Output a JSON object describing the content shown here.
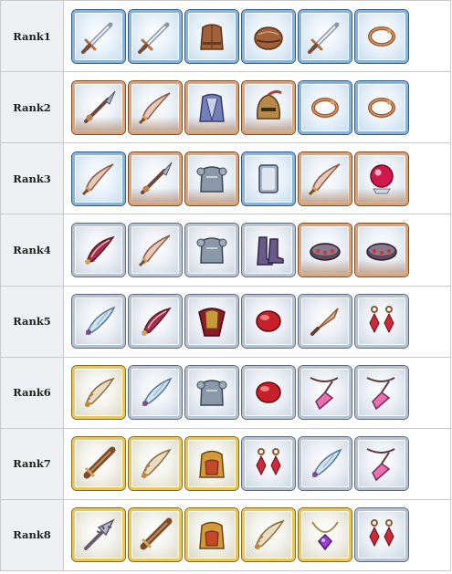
{
  "ranks": [
    {
      "label": "Rank1",
      "items": [
        {
          "frame": "blue",
          "icon": "sword-icon"
        },
        {
          "frame": "blue",
          "icon": "sword-icon"
        },
        {
          "frame": "blue",
          "icon": "leather-armor-icon"
        },
        {
          "frame": "blue",
          "icon": "leather-helmet-icon"
        },
        {
          "frame": "blue",
          "icon": "sword-icon"
        },
        {
          "frame": "blue",
          "icon": "bracelet-icon"
        }
      ]
    },
    {
      "label": "Rank2",
      "items": [
        {
          "frame": "bronze",
          "icon": "spear-icon"
        },
        {
          "frame": "bronze",
          "icon": "scimitar-icon"
        },
        {
          "frame": "bronze",
          "icon": "robe-armor-icon"
        },
        {
          "frame": "bronze",
          "icon": "knight-helmet-icon"
        },
        {
          "frame": "blue",
          "icon": "bracelet-icon"
        },
        {
          "frame": "blue",
          "icon": "bracelet-icon"
        }
      ]
    },
    {
      "label": "Rank3",
      "items": [
        {
          "frame": "blue",
          "icon": "scimitar-icon"
        },
        {
          "frame": "bronze",
          "icon": "spear-icon"
        },
        {
          "frame": "bronze",
          "icon": "plate-armor-icon"
        },
        {
          "frame": "blue",
          "icon": "shield-icon"
        },
        {
          "frame": "bronze",
          "icon": "scimitar-icon"
        },
        {
          "frame": "bronze",
          "icon": "crystal-ball-icon"
        }
      ]
    },
    {
      "label": "Rank4",
      "items": [
        {
          "frame": "silver",
          "icon": "curved-blade-icon"
        },
        {
          "frame": "silver",
          "icon": "scimitar-icon"
        },
        {
          "frame": "silver",
          "icon": "plate-armor-icon"
        },
        {
          "frame": "silver",
          "icon": "boots-icon"
        },
        {
          "frame": "bronze",
          "icon": "jeweled-bracer-icon"
        },
        {
          "frame": "bronze",
          "icon": "jeweled-bracer-icon"
        }
      ]
    },
    {
      "label": "Rank5",
      "items": [
        {
          "frame": "silver",
          "icon": "feather-blade-icon"
        },
        {
          "frame": "silver",
          "icon": "curved-blade-icon"
        },
        {
          "frame": "silver",
          "icon": "caped-armor-icon"
        },
        {
          "frame": "silver",
          "icon": "ruby-gem-icon"
        },
        {
          "frame": "silver",
          "icon": "dagger-icon"
        },
        {
          "frame": "silver",
          "icon": "earrings-icon"
        }
      ]
    },
    {
      "label": "Rank6",
      "items": [
        {
          "frame": "gold",
          "icon": "ornate-blade-icon"
        },
        {
          "frame": "silver",
          "icon": "feather-blade-icon"
        },
        {
          "frame": "silver",
          "icon": "plate-armor-icon"
        },
        {
          "frame": "silver",
          "icon": "ruby-gem-icon"
        },
        {
          "frame": "silver",
          "icon": "crystal-pendant-icon"
        },
        {
          "frame": "silver",
          "icon": "crystal-pendant-icon"
        }
      ]
    },
    {
      "label": "Rank7",
      "items": [
        {
          "frame": "gold",
          "icon": "greatsword-icon"
        },
        {
          "frame": "gold",
          "icon": "ornate-blade-icon"
        },
        {
          "frame": "gold",
          "icon": "royal-armor-icon"
        },
        {
          "frame": "silver",
          "icon": "earrings-icon"
        },
        {
          "frame": "silver",
          "icon": "feather-blade-icon"
        },
        {
          "frame": "silver",
          "icon": "crystal-pendant-icon"
        }
      ]
    },
    {
      "label": "Rank8",
      "items": [
        {
          "frame": "gold",
          "icon": "spiked-mace-icon"
        },
        {
          "frame": "gold",
          "icon": "greatsword-icon"
        },
        {
          "frame": "gold",
          "icon": "royal-armor-icon"
        },
        {
          "frame": "gold",
          "icon": "ornate-blade-icon"
        },
        {
          "frame": "gold",
          "icon": "amethyst-necklace-icon"
        },
        {
          "frame": "silver",
          "icon": "earrings-icon"
        }
      ]
    }
  ],
  "colors": {
    "tile_blue": "#8ab3d8",
    "tile_bronze": "#d9a57a",
    "tile_silver": "#b8c3d2",
    "tile_gold": "#e7c75e",
    "rank_label_bg": "#eef0f3"
  }
}
